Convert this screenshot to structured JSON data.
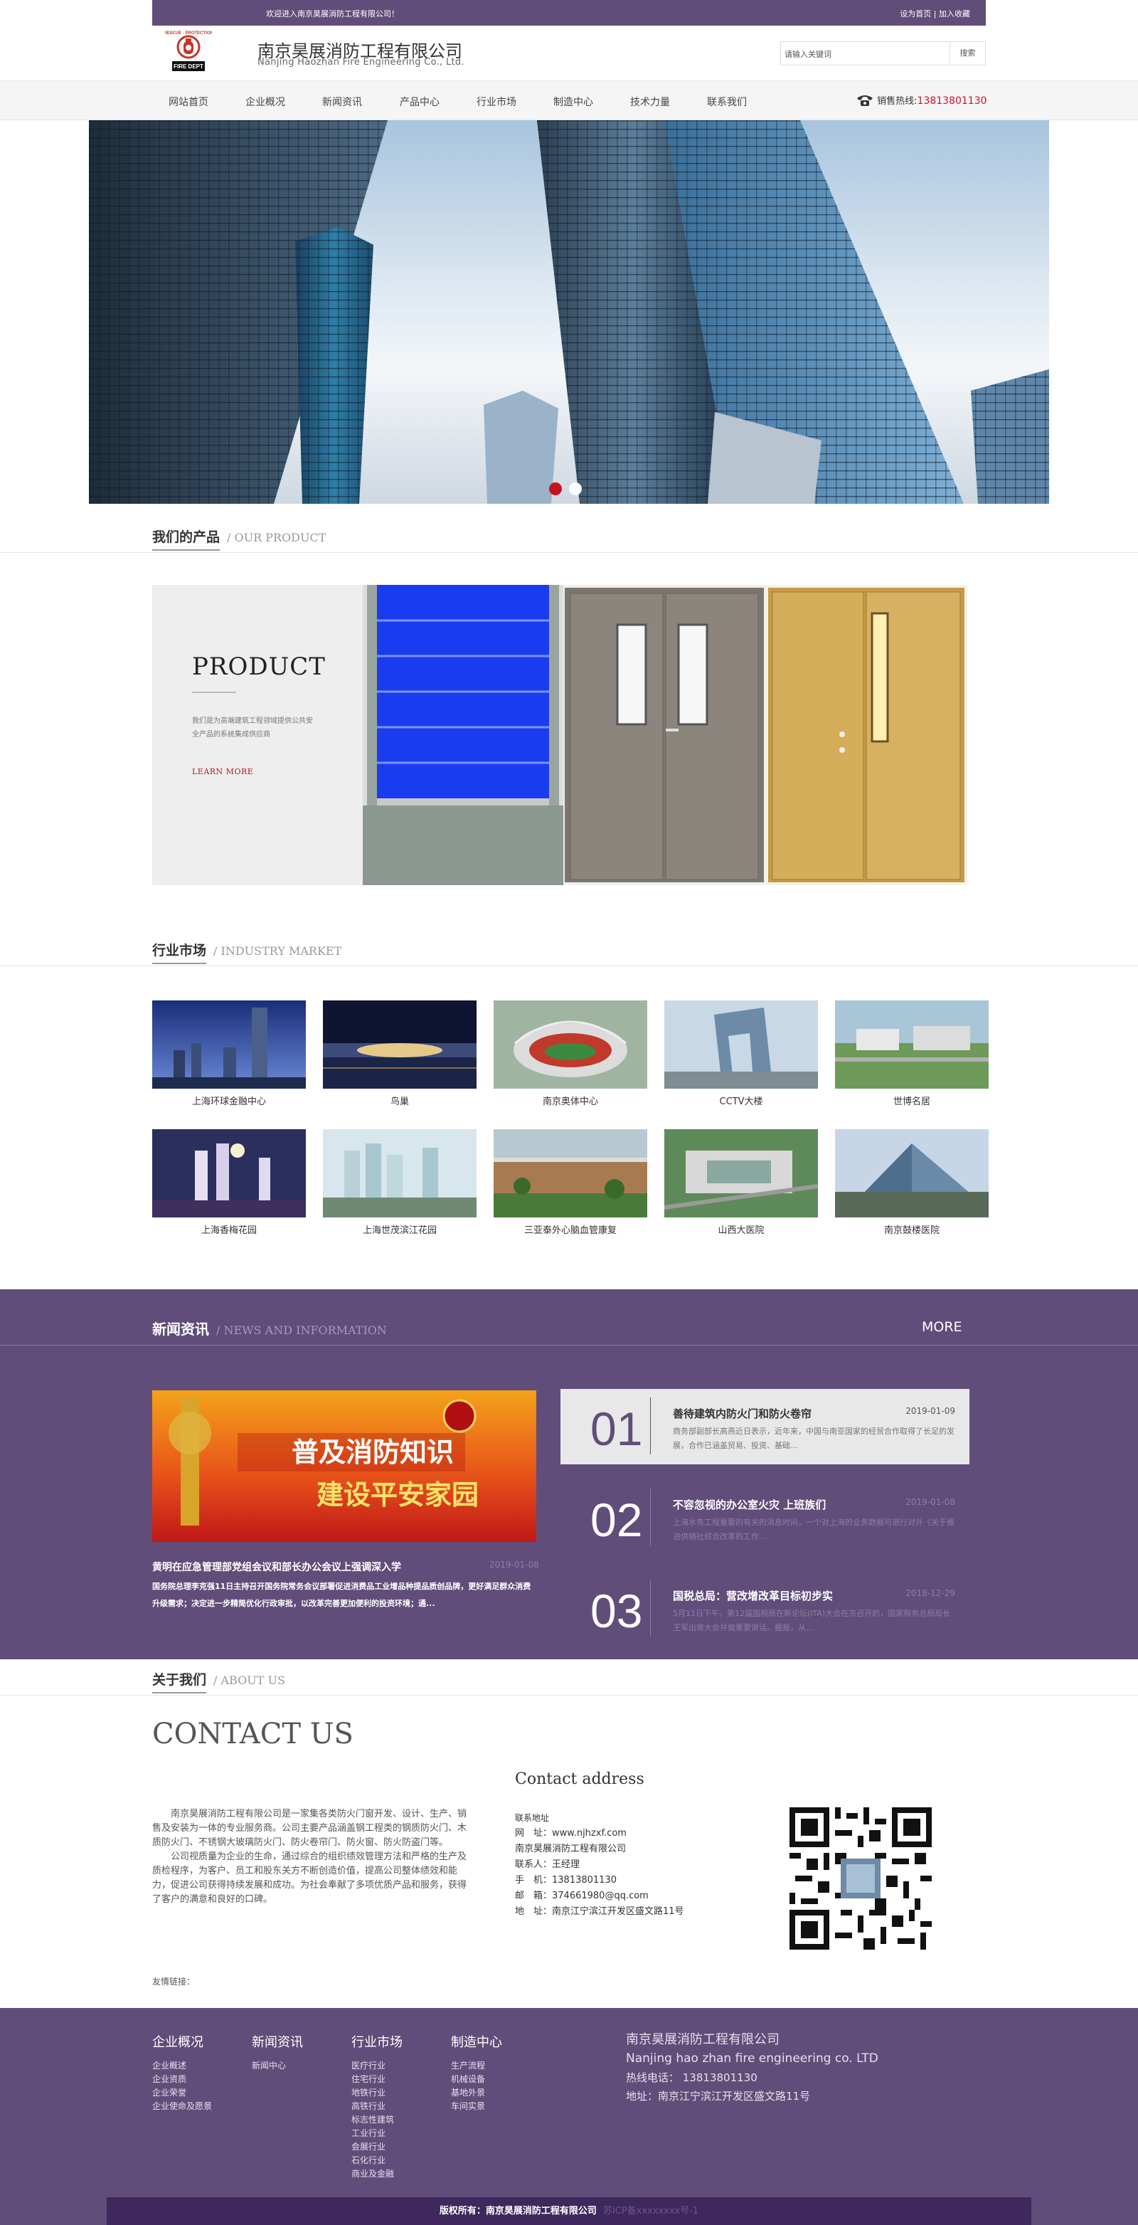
{
  "topbar": {
    "welcome": "欢迎进入南京昊展消防工程有限公司！",
    "links": "设为首页 | 加入收藏"
  },
  "header": {
    "company_cn": "南京昊展消防工程有限公司",
    "company_en": "Nanjing Haozhan Fire Engineering Co., Ltd.",
    "logo_text_top": "RESCUE AND PROTECTION",
    "logo_text_bottom": "FIRE DEPT",
    "search_placeholder": "请输入关键词",
    "search_button": "搜索"
  },
  "nav": {
    "items": [
      "网站首页",
      "企业概况",
      "新闻资讯",
      "产品中心",
      "行业市场",
      "制造中心",
      "技术力量",
      "联系我们"
    ],
    "hotline_label": "销售热线:",
    "hotline_number": "13813801130"
  },
  "product_section": {
    "title_cn": "我们的产品",
    "title_en": "/ OUR PRODUCT",
    "heading": "PRODUCT",
    "desc": "我们是为高端建筑工程领域提供公共安全产品的系统集成供应商",
    "more": "LEARN MORE"
  },
  "industry_section": {
    "title_cn": "行业市场",
    "title_en": "/ INDUSTRY MARKET",
    "items": [
      "上海环球金融中心",
      "鸟巢",
      "南京奥体中心",
      "CCTV大楼",
      "世博名居",
      "上海香梅花园",
      "上海世茂滨江花园",
      "三亚泰外心脑血管康复",
      "山西大医院",
      "南京鼓楼医院"
    ]
  },
  "news_section": {
    "title_cn": "新闻资讯",
    "title_en": "/ NEWS AND INFORMATION",
    "more": "MORE",
    "banner_text_1": "普及消防知识",
    "banner_text_2": "建设平安家园",
    "featured": {
      "title": "黄明在应急管理部党组会议和部长办公会议上强调深入学",
      "date": "2019-01-08",
      "summary": "国务院总理李克强11日主持召开国务院常务会议部署促进消费品工业增品种提品质创品牌，更好满足群众消费升级需求；决定进一步精简优化行政审批，以改革完善更加便利的投资环境；通..."
    },
    "items": [
      {
        "num": "01",
        "title": "善待建筑内防火门和防火卷帘",
        "date": "2019-01-09",
        "summary": "商务部副部长高燕近日表示，近年来，中国与南亚国家的经贸合作取得了长足的发展，合作已涵盖贸易、投资、基础..."
      },
      {
        "num": "02",
        "title": "不容忽视的办公室火灾 上班族们",
        "date": "2019-01-08",
        "summary": "上海水务工程重要的有关的消息时间，一个对上海的业务数据可进行对外《关于推进供销社综合改革的工作..."
      },
      {
        "num": "03",
        "title": "国税总局：营改增改革目标初步实",
        "date": "2018-12-29",
        "summary": "5月11日下午，第12届国税局在新论坛(ITA)大会在京召开的，国家税务总局局长王军出席大会并做重要讲话。据报，从..."
      }
    ]
  },
  "about_section": {
    "title_cn": "关于我们",
    "title_en": "/ ABOUT US",
    "contact_heading": "CONTACT US",
    "intro_1": "南京昊展消防工程有限公司是一家集各类防火门窗开发、设计、生产、销售及安装为一体的专业服务商。公司主要产品涵盖钢工程类的钢质防火门、木质防火门、不锈钢大玻璃防火门、防火卷帘门、防火窗、防火防盗门等。",
    "intro_2": "公司视质量为企业的生命，通过综合的组织绩效管理方法和严格的生产及质检程序，为客户、员工和股东关方不断创造价值，提高公司整体绩效和能力，促进公司获得持续发展和成功。为社会奉献了多项优质产品和服务，获得了客户的满意和良好的口碑。",
    "contact_address_title": "Contact address",
    "contact_lines": [
      "联系地址",
      "网　址：www.njhzxf.com",
      "南京昊展消防工程有限公司",
      "联系人：王经理",
      "手　机：13813801130",
      "邮　箱：374661980@qq.com",
      "地　址：南京江宁滨江开发区盛文路11号"
    ],
    "friend_links": "友情链接："
  },
  "footer": {
    "cols": [
      {
        "title": "企业概况",
        "items": [
          "企业概述",
          "企业资质",
          "企业荣誉",
          "企业使命及愿景"
        ]
      },
      {
        "title": "新闻资讯",
        "items": [
          "新闻中心"
        ]
      },
      {
        "title": "行业市场",
        "items": [
          "医疗行业",
          "住宅行业",
          "地铁行业",
          "高铁行业",
          "标志性建筑",
          "工业行业",
          "会展行业",
          "石化行业",
          "商业及金融"
        ]
      },
      {
        "title": "制造中心",
        "items": [
          "生产流程",
          "机械设备",
          "基地外景",
          "车间实景"
        ]
      }
    ],
    "company_cn": "南京昊展消防工程有限公司",
    "company_en": "Nanjing hao zhan fire engineering co. LTD",
    "hotline": "热线电话： 13813801130",
    "address": "地址：南京江宁滨江开发区盛文路11号",
    "copyright": "版权所有：南京昊展消防工程有限公司",
    "icp": "苏ICP备xxxxxxxx号-1"
  }
}
